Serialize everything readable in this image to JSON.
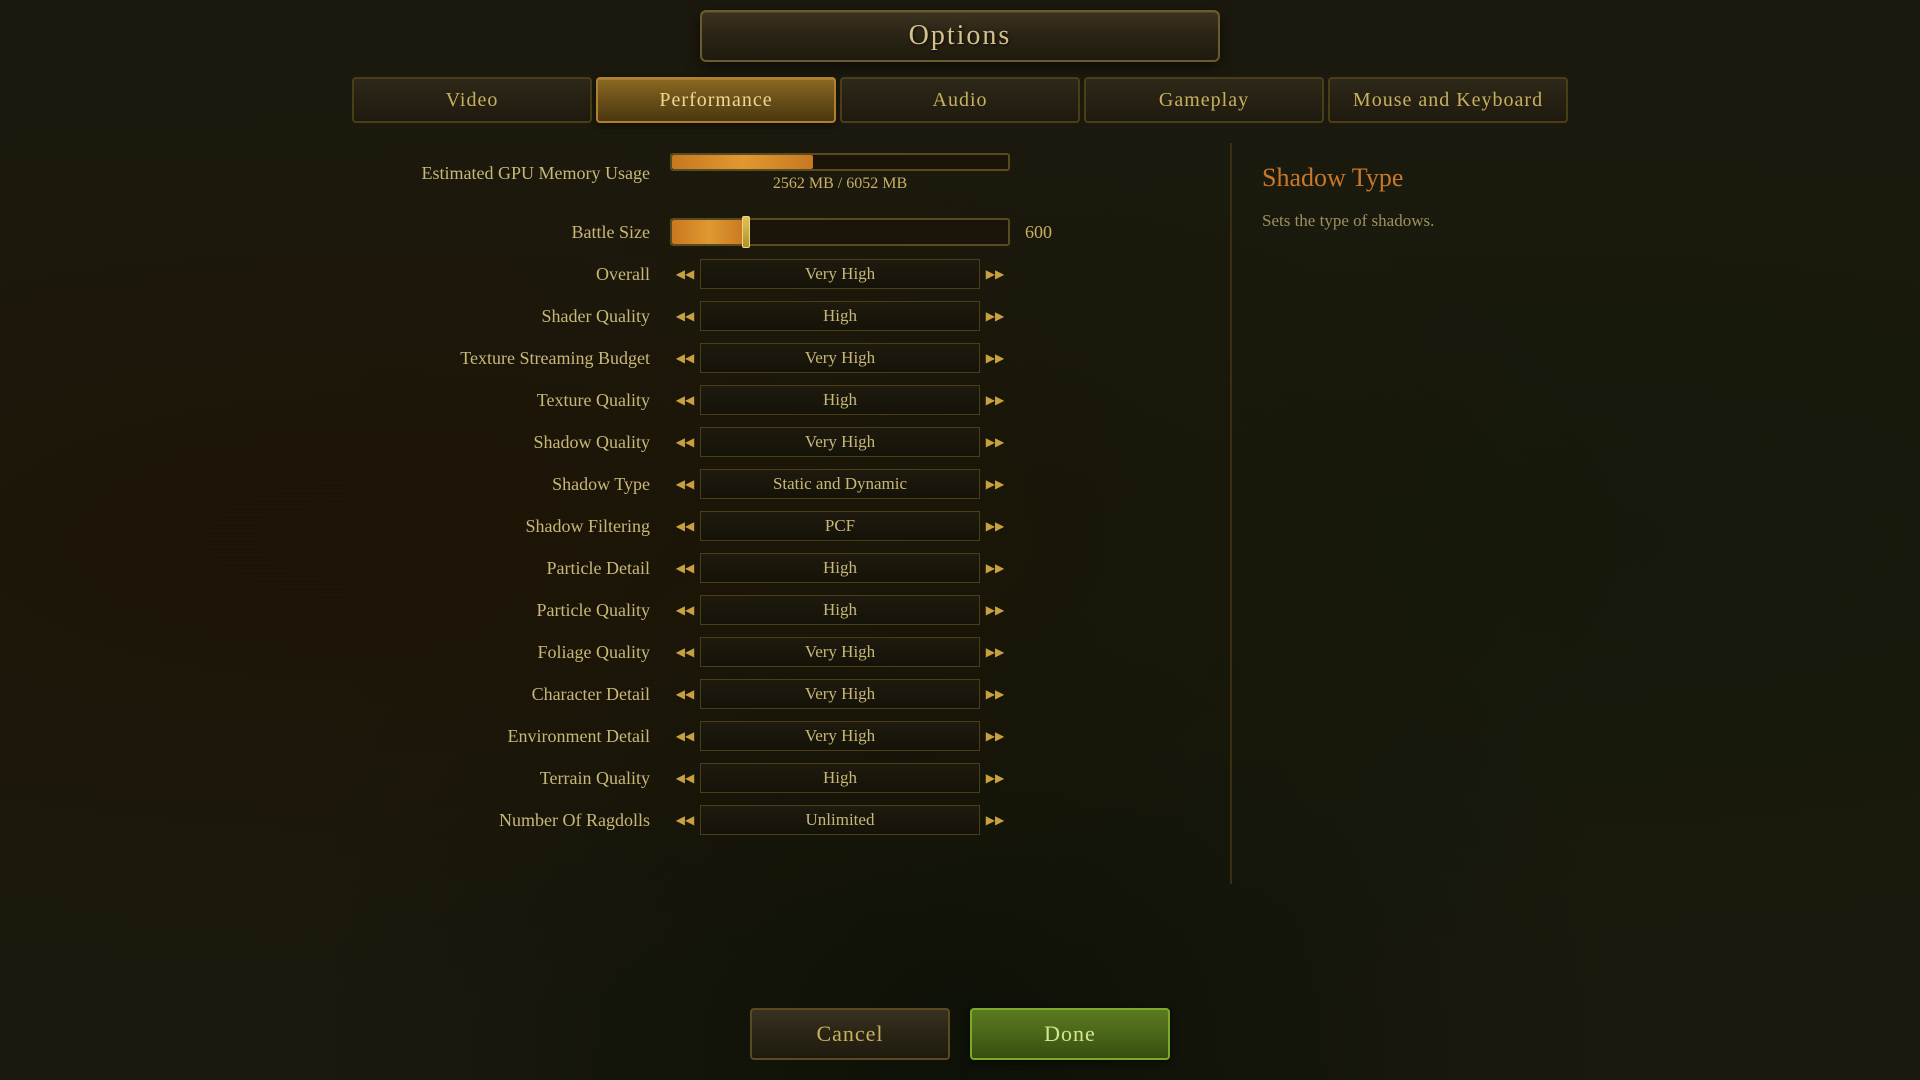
{
  "title": "Options",
  "tabs": [
    {
      "id": "video",
      "label": "Video",
      "active": false
    },
    {
      "id": "performance",
      "label": "Performance",
      "active": true
    },
    {
      "id": "audio",
      "label": "Audio",
      "active": false
    },
    {
      "id": "gameplay",
      "label": "Gameplay",
      "active": false
    },
    {
      "id": "mouse-keyboard",
      "label": "Mouse and Keyboard",
      "active": false
    }
  ],
  "gpu": {
    "label": "Estimated GPU Memory Usage",
    "used": "2562 MB",
    "total": "6052 MB",
    "display": "2562 MB / 6052 MB",
    "percent": 42
  },
  "battle_size": {
    "label": "Battle Size",
    "value": "600"
  },
  "settings": [
    {
      "id": "overall",
      "label": "Overall",
      "value": "Very High"
    },
    {
      "id": "shader-quality",
      "label": "Shader Quality",
      "value": "High"
    },
    {
      "id": "texture-streaming-budget",
      "label": "Texture Streaming Budget",
      "value": "Very High"
    },
    {
      "id": "texture-quality",
      "label": "Texture Quality",
      "value": "High"
    },
    {
      "id": "shadow-quality",
      "label": "Shadow Quality",
      "value": "Very High"
    },
    {
      "id": "shadow-type",
      "label": "Shadow Type",
      "value": "Static and Dynamic"
    },
    {
      "id": "shadow-filtering",
      "label": "Shadow Filtering",
      "value": "PCF"
    },
    {
      "id": "particle-detail",
      "label": "Particle Detail",
      "value": "High"
    },
    {
      "id": "particle-quality",
      "label": "Particle Quality",
      "value": "High"
    },
    {
      "id": "foliage-quality",
      "label": "Foliage Quality",
      "value": "Very High"
    },
    {
      "id": "character-detail",
      "label": "Character Detail",
      "value": "Very High"
    },
    {
      "id": "environment-detail",
      "label": "Environment Detail",
      "value": "Very High"
    },
    {
      "id": "terrain-quality",
      "label": "Terrain Quality",
      "value": "High"
    },
    {
      "id": "number-of-ragdolls",
      "label": "Number Of Ragdolls",
      "value": "Unlimited"
    }
  ],
  "info_panel": {
    "title": "Shadow Type",
    "description": "Sets the type of shadows."
  },
  "buttons": {
    "cancel": "Cancel",
    "done": "Done"
  }
}
